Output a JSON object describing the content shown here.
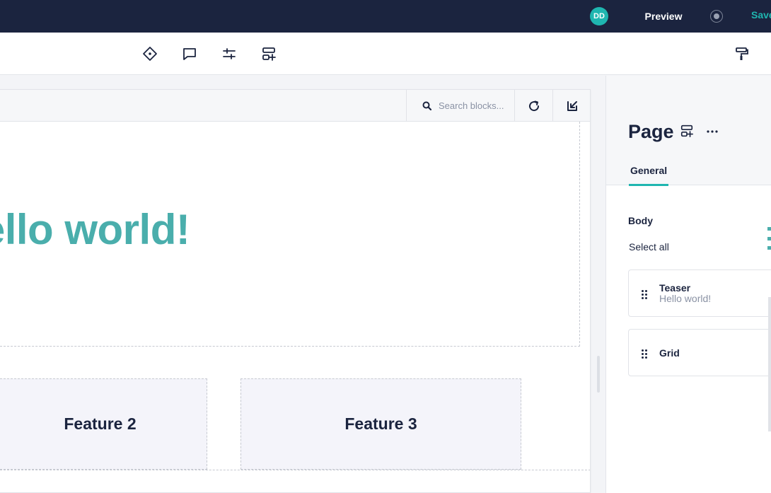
{
  "topbar": {
    "avatar_initials": "DD",
    "preview_label": "Preview",
    "save_label": "Save",
    "status_icon": "record-icon"
  },
  "toolbar": {
    "tools": [
      "diamond-icon",
      "comment-icon",
      "sliders-icon",
      "add-block-icon"
    ],
    "right_tool": "paint-roller-icon"
  },
  "canvas": {
    "search_placeholder": "Search blocks...",
    "refresh_icon": "refresh-icon",
    "collapse_icon": "arrow-down-left-icon",
    "teaser_title": "Hello world!",
    "features": [
      "Feature 2",
      "Feature 3"
    ]
  },
  "panel": {
    "title": "Page",
    "tab_general": "General",
    "section_label": "Body",
    "select_all": "Select all",
    "blocks": [
      {
        "title": "Teaser",
        "subtitle": "Hello world!"
      },
      {
        "title": "Grid",
        "subtitle": ""
      }
    ]
  },
  "colors": {
    "topbar_bg": "#1b243f",
    "accent": "#1fb6b0",
    "heading_teal": "#4aaeac"
  }
}
